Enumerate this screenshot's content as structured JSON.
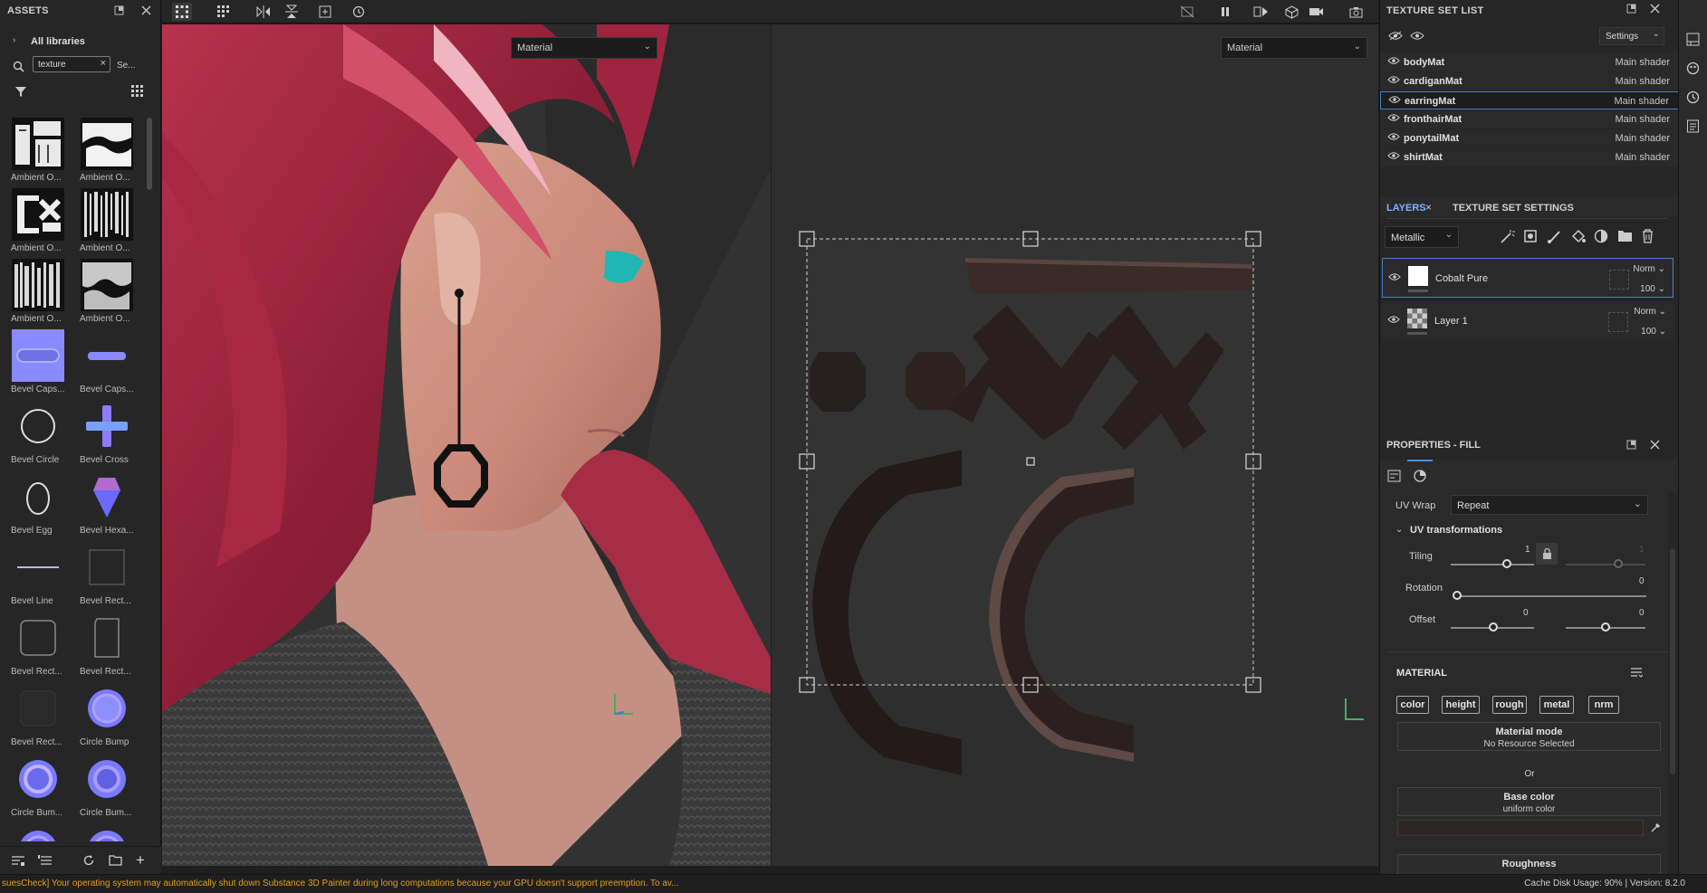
{
  "assets": {
    "title": "ASSETS",
    "breadcrumb": "All libraries",
    "search_value": "texture",
    "search_more": "Se...",
    "items": [
      {
        "label": "Ambient O...",
        "kind": "ao1"
      },
      {
        "label": "Ambient O...",
        "kind": "ao2"
      },
      {
        "label": "Ambient O...",
        "kind": "ao3"
      },
      {
        "label": "Ambient O...",
        "kind": "ao4"
      },
      {
        "label": "Ambient O...",
        "kind": "ao5"
      },
      {
        "label": "Ambient O...",
        "kind": "ao6"
      },
      {
        "label": "Bevel Caps...",
        "kind": "caps1"
      },
      {
        "label": "Bevel Caps...",
        "kind": "caps2"
      },
      {
        "label": "Bevel Circle",
        "kind": "circle"
      },
      {
        "label": "Bevel Cross",
        "kind": "cross"
      },
      {
        "label": "Bevel Egg",
        "kind": "egg"
      },
      {
        "label": "Bevel Hexa...",
        "kind": "hexa"
      },
      {
        "label": "Bevel Line",
        "kind": "line"
      },
      {
        "label": "Bevel Rect...",
        "kind": "rect1"
      },
      {
        "label": "Bevel Rect...",
        "kind": "rect2"
      },
      {
        "label": "Bevel Rect...",
        "kind": "rect3"
      },
      {
        "label": "Bevel Rect...",
        "kind": "rect4"
      },
      {
        "label": "Circle Bump",
        "kind": "bump1"
      },
      {
        "label": "Circle Bum...",
        "kind": "bump2"
      },
      {
        "label": "Circle Bum...",
        "kind": "bump3"
      }
    ]
  },
  "viewport": {
    "left_dropdown": "Material",
    "right_dropdown": "Material"
  },
  "texture_set_list": {
    "title": "TEXTURE SET LIST",
    "settings_label": "Settings",
    "rows": [
      {
        "name": "bodyMat",
        "shader": "Main shader"
      },
      {
        "name": "cardiganMat",
        "shader": "Main shader"
      },
      {
        "name": "earringMat",
        "shader": "Main shader"
      },
      {
        "name": "fronthairMat",
        "shader": "Main shader"
      },
      {
        "name": "ponytailMat",
        "shader": "Main shader"
      },
      {
        "name": "shirtMat",
        "shader": "Main shader"
      }
    ]
  },
  "layers": {
    "tab_layers": "LAYERS",
    "tab_settings": "TEXTURE SET SETTINGS",
    "channel": "Metallic",
    "items": [
      {
        "name": "Cobalt Pure",
        "blend": "Norm",
        "opacity": "100"
      },
      {
        "name": "Layer 1",
        "blend": "Norm",
        "opacity": "100"
      }
    ]
  },
  "properties": {
    "title": "PROPERTIES - FILL",
    "uv_wrap_label": "UV Wrap",
    "uv_wrap_value": "Repeat",
    "uv_transforms": "UV transformations",
    "tiling_label": "Tiling",
    "tiling_value": "1",
    "tiling_value2": "1",
    "rotation_label": "Rotation",
    "rotation_value": "0",
    "offset_label": "Offset",
    "offset_value1": "0",
    "offset_value2": "0",
    "material_title": "MATERIAL",
    "chips": [
      "color",
      "height",
      "rough",
      "metal",
      "nrm"
    ],
    "material_mode": "Material mode",
    "no_resource": "No Resource Selected",
    "or": "Or",
    "base_color": "Base color",
    "uniform_color": "uniform color",
    "roughness": "Roughness"
  },
  "status": {
    "warning": "suesCheck] Your operating system may automatically shut down Substance 3D Painter during long computations because your GPU doesn't support preemption. To av...",
    "info": "Cache Disk Usage:  90% | Version: 8.2.0"
  }
}
